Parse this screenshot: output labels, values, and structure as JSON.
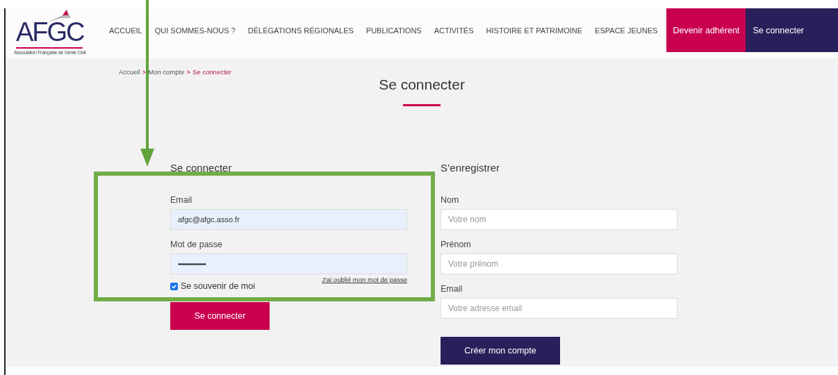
{
  "logo": {
    "text": "AFGC",
    "subtitle": "Association Française de Génie Civil"
  },
  "nav": [
    {
      "label": "ACCUEIL",
      "kind": "link"
    },
    {
      "label": "QUI SOMMES-NOUS ?",
      "kind": "link"
    },
    {
      "label": "DÉLÉGATIONS RÉGIONALES",
      "kind": "link"
    },
    {
      "label": "PUBLICATIONS",
      "kind": "link"
    },
    {
      "label": "ACTIVITÉS",
      "kind": "link"
    },
    {
      "label": "HISTOIRE ET PATRIMOINE",
      "kind": "link"
    },
    {
      "label": "ESPACE JEUNES",
      "kind": "link"
    },
    {
      "label": "Devenir adhérent",
      "kind": "primary"
    },
    {
      "label": "Se connecter",
      "kind": "secondary"
    }
  ],
  "breadcrumb": [
    {
      "label": "Accueil",
      "selected": false
    },
    {
      "label": "Mon compte",
      "selected": false
    },
    {
      "label": "Se connecter",
      "selected": true
    }
  ],
  "breadcrumb_separator": ">",
  "page_title": "Se connecter",
  "login": {
    "heading": "Se connecter",
    "fields": [
      {
        "label": "Email",
        "value": "afgc@afgc.asso.fr",
        "kind": "text"
      },
      {
        "label": "Mot de passe",
        "value": "••••••••••••••",
        "kind": "password"
      }
    ],
    "forgot_link": "J'ai oublié mon mot de passe",
    "remember": {
      "label": "Se souvenir de moi",
      "checked": true
    },
    "button": "Se connecter"
  },
  "register": {
    "heading": "S’enregistrer",
    "fields": [
      {
        "label": "Nom",
        "placeholder": "Votre nom"
      },
      {
        "label": "Prénom",
        "placeholder": "Votre prénom"
      },
      {
        "label": "Email",
        "placeholder": "Votre adresse email"
      }
    ],
    "button": "Créer mon compte"
  }
}
